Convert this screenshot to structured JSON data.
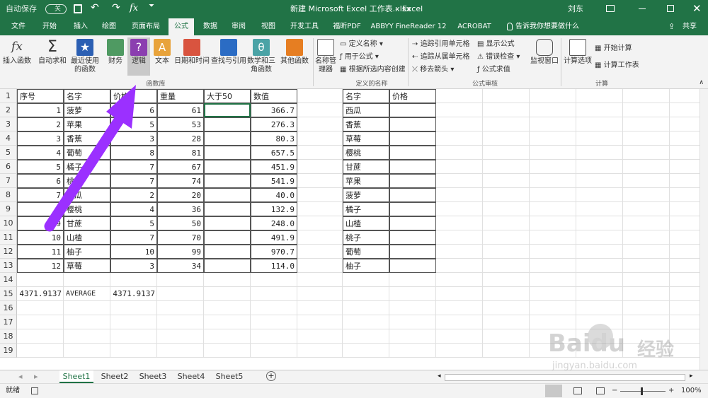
{
  "titlebar": {
    "autosave": "自动保存",
    "autosave_state": "关",
    "doc_title": "新建 Microsoft Excel 工作表.xlsx",
    "app": "Excel",
    "user": "刘东"
  },
  "tabs": [
    "文件",
    "开始",
    "插入",
    "绘图",
    "页面布局",
    "公式",
    "数据",
    "审阅",
    "视图",
    "开发工具",
    "福昕PDF",
    "ABBYY FineReader 12",
    "ACROBAT"
  ],
  "active_tab": "公式",
  "tellme": "告诉我你想要做什么",
  "share": "共享",
  "ribbon": {
    "big": [
      "插入函数",
      "自动求和",
      "最近使用的函数",
      "财务",
      "逻辑",
      "文本",
      "日期和时间",
      "查找与引用",
      "数学和三角函数",
      "其他函数",
      "名称管理器",
      "监视窗口",
      "计算选项"
    ],
    "small": [
      "定义名称",
      "用于公式",
      "根据所选内容创建",
      "追踪引用单元格",
      "追踪从属单元格",
      "移去箭头",
      "显示公式",
      "错误检查",
      "公式求值",
      "开始计算",
      "计算工作表"
    ],
    "groups": [
      "函数库",
      "定义的名称",
      "公式审核",
      "计算"
    ]
  },
  "rows": [
    "1",
    "2",
    "3",
    "4",
    "5",
    "6",
    "7",
    "8",
    "9",
    "10",
    "11",
    "12",
    "13",
    "14",
    "15",
    "16",
    "17",
    "18",
    "19"
  ],
  "table1": {
    "headers": [
      "序号",
      "名字",
      "价格",
      "重量",
      "大于50",
      "数值"
    ],
    "data": [
      [
        "1",
        "菠萝",
        "6",
        "61",
        "",
        "366.7"
      ],
      [
        "2",
        "苹果",
        "5",
        "53",
        "",
        "276.3"
      ],
      [
        "3",
        "香蕉",
        "3",
        "28",
        "",
        "80.3"
      ],
      [
        "4",
        "葡萄",
        "8",
        "81",
        "",
        "657.5"
      ],
      [
        "5",
        "橘子",
        "7",
        "67",
        "",
        "451.9"
      ],
      [
        "6",
        "桃子",
        "7",
        "74",
        "",
        "541.9"
      ],
      [
        "7",
        "西瓜",
        "2",
        "20",
        "",
        "40.0"
      ],
      [
        "8",
        "樱桃",
        "4",
        "36",
        "",
        "132.9"
      ],
      [
        "9",
        "甘蔗",
        "5",
        "50",
        "",
        "248.0"
      ],
      [
        "10",
        "山楂",
        "7",
        "70",
        "",
        "491.9"
      ],
      [
        "11",
        "柚子",
        "10",
        "99",
        "",
        "970.7"
      ],
      [
        "12",
        "草莓",
        "3",
        "34",
        "",
        "114.0"
      ]
    ]
  },
  "row15": [
    "4371.9137",
    "AVERAGE",
    "4371.9137"
  ],
  "table2": {
    "headers": [
      "名字",
      "价格"
    ],
    "names": [
      "西瓜",
      "香蕉",
      "草莓",
      "樱桃",
      "甘蔗",
      "苹果",
      "菠萝",
      "橘子",
      "山楂",
      "桃子",
      "葡萄",
      "柚子"
    ]
  },
  "sheets": [
    "Sheet1",
    "Sheet2",
    "Sheet3",
    "Sheet4",
    "Sheet5"
  ],
  "active_sheet": "Sheet1",
  "status": {
    "ready": "就绪",
    "zoom": "100%"
  },
  "watermark": {
    "brand": "Baidu",
    "cn": "经验",
    "url": "jingyan.baidu.com"
  },
  "colors": {
    "excel_green": "#217346",
    "arrow": "#9b30ff"
  }
}
